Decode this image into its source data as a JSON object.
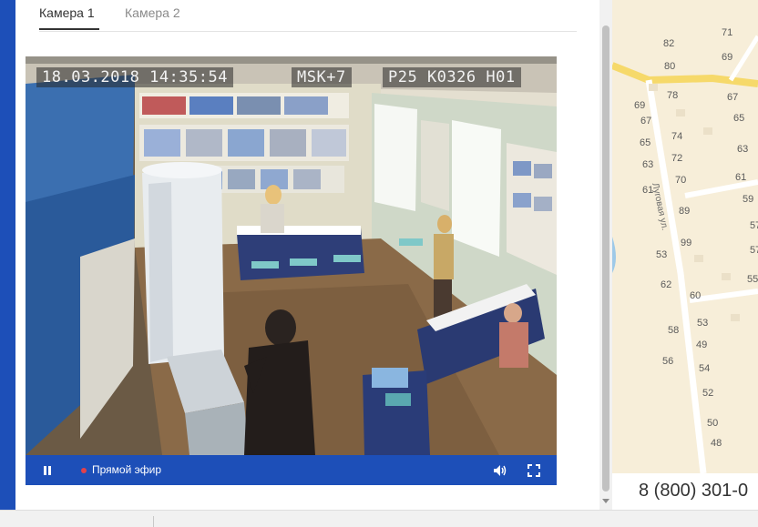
{
  "tabs": [
    {
      "label": "Камера 1",
      "active": true
    },
    {
      "label": "Камера 2",
      "active": false
    }
  ],
  "video": {
    "timestamp": "18.03.2018 14:35:54",
    "timezone": "MSK+7",
    "camera_code": "P25 K0326 H01"
  },
  "controls": {
    "pause_icon": "pause-icon",
    "live_label": "Прямой эфир",
    "live_color": "#e2414b",
    "volume_icon": "volume-icon",
    "fullscreen_icon": "fullscreen-icon",
    "bar_color": "#1d4fb8"
  },
  "map": {
    "street": "Луговая ул.",
    "house_numbers": [
      "71",
      "82",
      "69",
      "80",
      "78",
      "67",
      "69",
      "67",
      "65",
      "74",
      "65",
      "63",
      "72",
      "63",
      "61",
      "70",
      "61",
      "59",
      "89",
      "57",
      "99",
      "57",
      "53",
      "55",
      "62",
      "60",
      "53",
      "58",
      "49",
      "56",
      "54",
      "52",
      "50",
      "48"
    ]
  },
  "phone": "8 (800) 301-0"
}
